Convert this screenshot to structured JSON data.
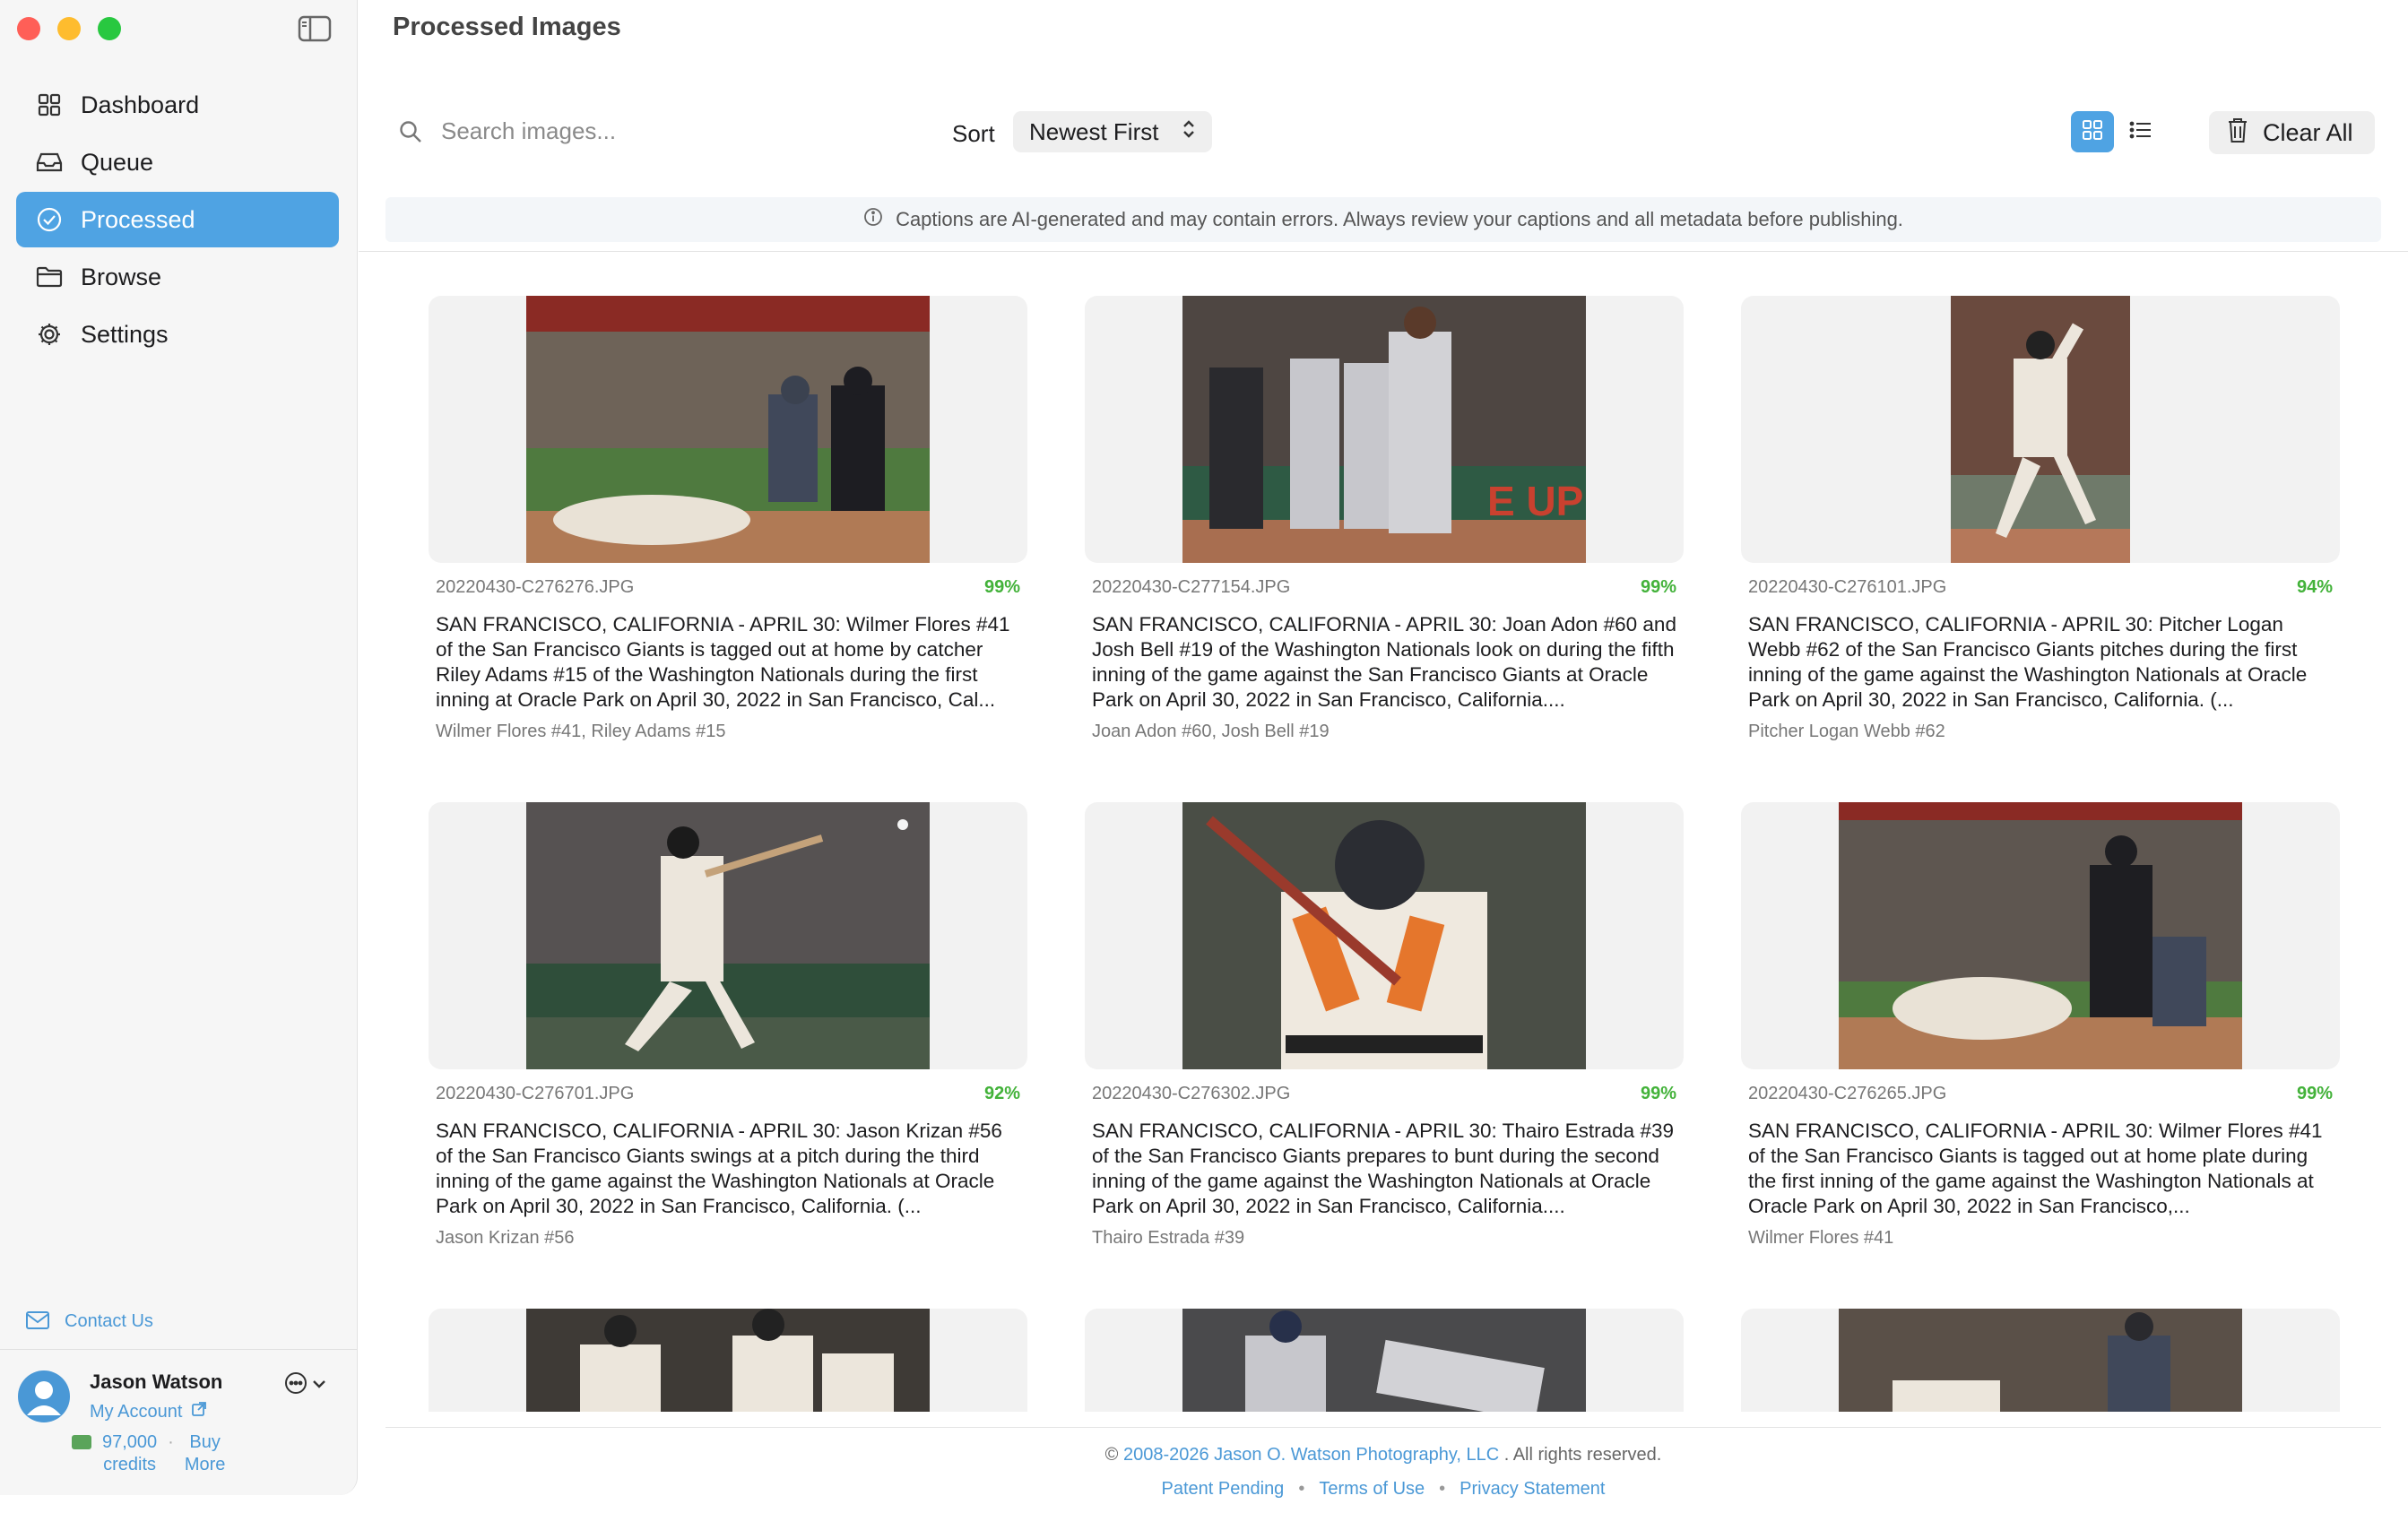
{
  "window": {
    "title": "Processed Images"
  },
  "sidebar": {
    "items": [
      {
        "label": "Dashboard",
        "icon": "grid-icon",
        "active": false
      },
      {
        "label": "Queue",
        "icon": "tray-icon",
        "active": false
      },
      {
        "label": "Processed",
        "icon": "checkmark-circle-icon",
        "active": true
      },
      {
        "label": "Browse",
        "icon": "folder-icon",
        "active": false
      },
      {
        "label": "Settings",
        "icon": "gear-icon",
        "active": false
      }
    ],
    "contact_label": "Contact Us",
    "user": {
      "name": "Jason Watson",
      "account_label": "My Account",
      "credits_value": "97,000",
      "credits_unit": "credits",
      "buy_label_1": "Buy",
      "buy_label_2": "More"
    }
  },
  "toolbar": {
    "search_placeholder": "Search images...",
    "sort_label": "Sort",
    "sort_value": "Newest First",
    "clear_label": "Clear All",
    "view_mode": "grid"
  },
  "notice": "Captions are AI-generated and may contain errors. Always review your captions and all metadata before publishing.",
  "images": [
    {
      "filename": "20220430-C276276.JPG",
      "score": "99%",
      "caption": "SAN FRANCISCO, CALIFORNIA - APRIL 30: Wilmer Flores #41 of the San Francisco Giants is tagged out at home by catcher Riley Adams #15 of the Washington Nationals during the first inning at Oracle Park on April 30, 2022 in San Francisco, Cal...",
      "people": "Wilmer Flores #41, Riley Adams #15"
    },
    {
      "filename": "20220430-C277154.JPG",
      "score": "99%",
      "caption": "SAN FRANCISCO, CALIFORNIA - APRIL 30: Joan Adon #60 and Josh Bell #19 of the Washington Nationals look on during the fifth inning of the game against the San Francisco Giants at Oracle Park on April 30, 2022 in San Francisco, California....",
      "people": "Joan Adon #60, Josh Bell #19"
    },
    {
      "filename": "20220430-C276101.JPG",
      "score": "94%",
      "caption": "SAN FRANCISCO, CALIFORNIA - APRIL 30: Pitcher Logan Webb #62 of the San Francisco Giants pitches during the first inning of the game against the Washington Nationals at Oracle Park on April 30, 2022 in San Francisco, California. (...",
      "people": "Pitcher Logan Webb #62"
    },
    {
      "filename": "20220430-C276701.JPG",
      "score": "92%",
      "caption": "SAN FRANCISCO, CALIFORNIA - APRIL 30: Jason Krizan #56 of the San Francisco Giants swings at a pitch during the third inning of the game against the Washington Nationals at Oracle Park on April 30, 2022 in San Francisco, California. (...",
      "people": "Jason Krizan #56"
    },
    {
      "filename": "20220430-C276302.JPG",
      "score": "99%",
      "caption": "SAN FRANCISCO, CALIFORNIA - APRIL 30: Thairo Estrada #39 of the San Francisco Giants prepares to bunt during the second inning of the game against the Washington Nationals at Oracle Park on April 30, 2022 in San Francisco, California....",
      "people": "Thairo Estrada #39"
    },
    {
      "filename": "20220430-C276265.JPG",
      "score": "99%",
      "caption": "SAN FRANCISCO, CALIFORNIA - APRIL 30: Wilmer Flores #41 of the San Francisco Giants is tagged out at home plate during the first inning of the game against the Washington Nationals at Oracle Park on April 30, 2022 in San Francisco,...",
      "people": "Wilmer Flores #41"
    }
  ],
  "footer": {
    "copyright_symbol": "©",
    "copyright_years_owner": "2008-2026 Jason O. Watson Photography, LLC",
    "rights": ". All rights reserved.",
    "links": [
      "Patent Pending",
      "Terms of Use",
      "Privacy Statement"
    ]
  },
  "colors": {
    "accent": "#4fa3e3",
    "link": "#4a98d6",
    "score": "#43b23a"
  }
}
